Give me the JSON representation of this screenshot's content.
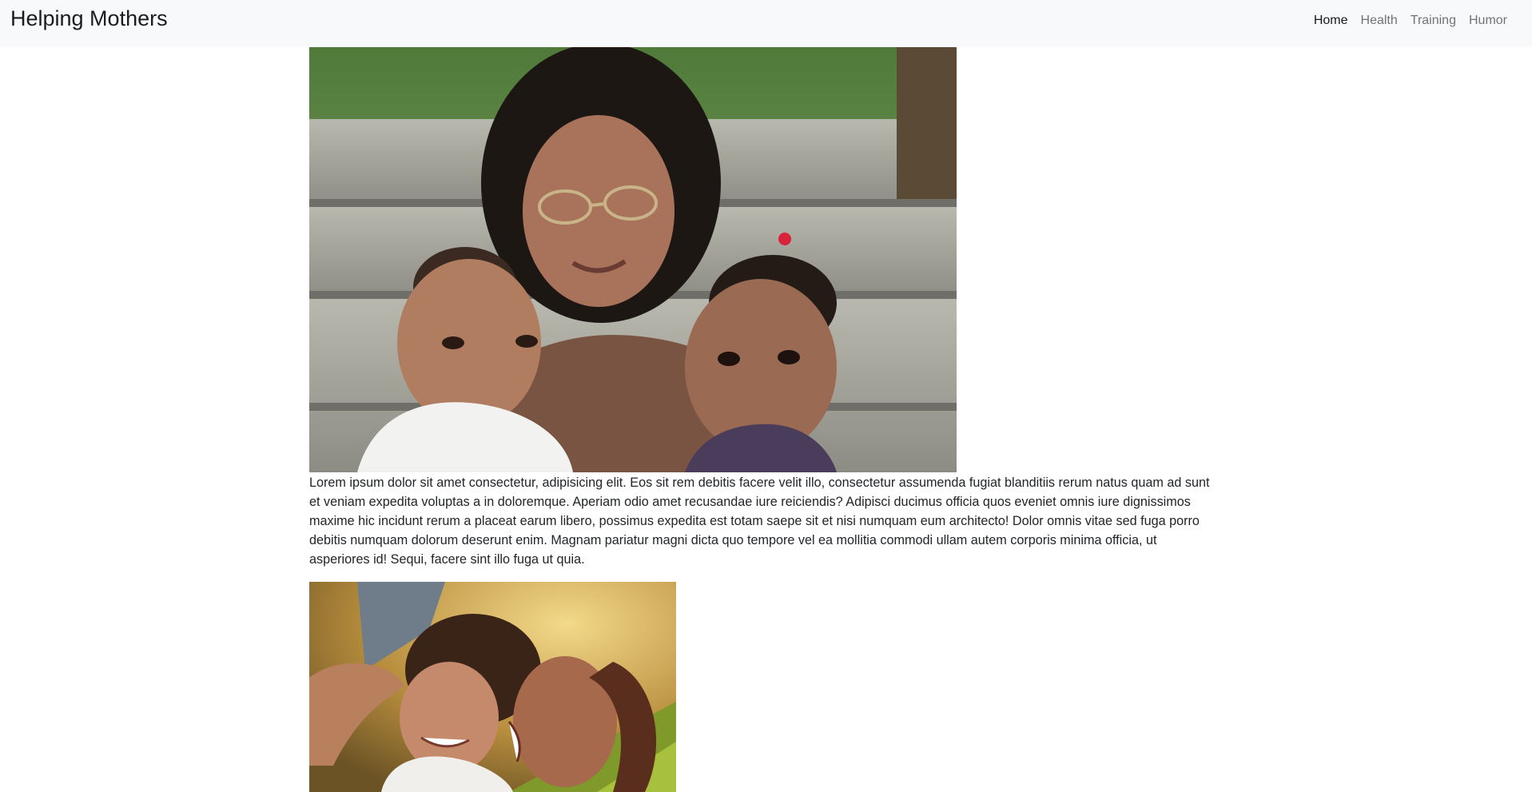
{
  "navbar": {
    "brand": "Helping Mothers",
    "links": [
      {
        "label": "Home",
        "active": true
      },
      {
        "label": "Health",
        "active": false
      },
      {
        "label": "Training",
        "active": false
      },
      {
        "label": "Humor",
        "active": false
      }
    ]
  },
  "main": {
    "paragraph": "Lorem ipsum dolor sit amet consectetur, adipisicing elit. Eos sit rem debitis facere velit illo, consectetur assumenda fugiat blanditiis rerum natus quam ad sunt et veniam expedita voluptas a in doloremque. Aperiam odio amet recusandae iure reiciendis? Adipisci ducimus officia quos eveniet omnis iure dignissimos maxime hic incidunt rerum a placeat earum libero, possimus expedita est totam saepe sit et nisi numquam eum architecto! Dolor omnis vitae sed fuga porro debitis numquam dolorum deserunt enim. Magnam pariatur magni dicta quo tempore vel ea mollitia commodi ullam autem corporis minima officia, ut asperiores id! Sequi, facere sint illo fuga ut quia."
  },
  "colors": {
    "navbar_bg": "#f8f9fa",
    "nav_active": "#000000e6",
    "nav_inactive": "#0000008c"
  }
}
